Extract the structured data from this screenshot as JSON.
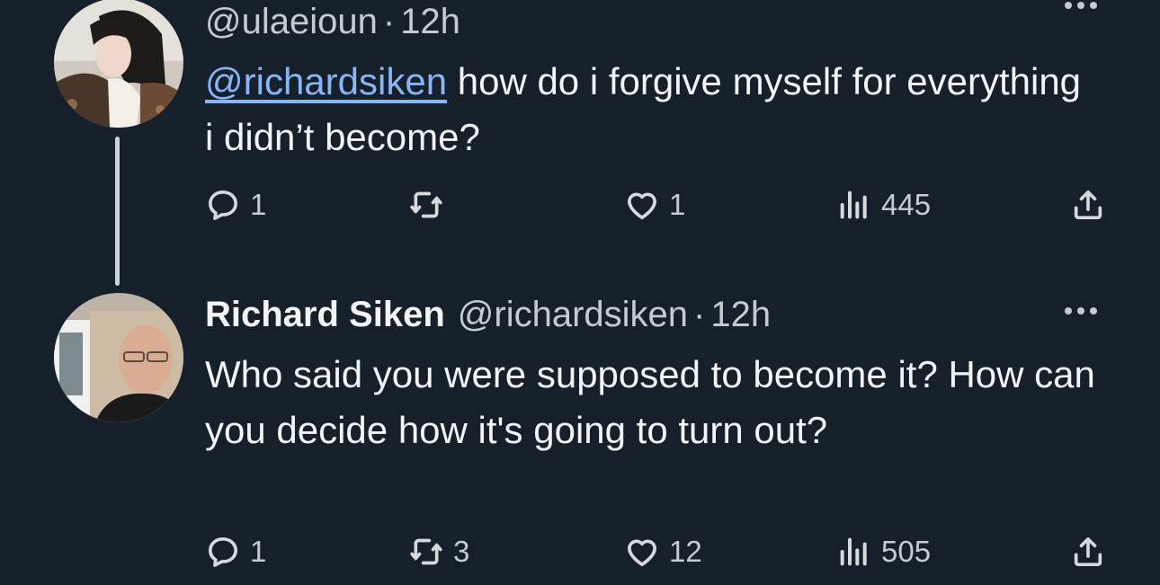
{
  "tweets": [
    {
      "handle": "@ulaeioun",
      "time": "12h",
      "mention": "@richardsiken",
      "text": "how do i forgive myself for everything i didn’t become?",
      "replies": "1",
      "retweets": "",
      "likes": "1",
      "views": "445",
      "icons": [
        "reply-icon",
        "retweet-icon",
        "like-icon",
        "views-icon",
        "share-icon",
        "more-icon"
      ]
    },
    {
      "name": "Richard Siken",
      "handle": "@richardsiken",
      "time": "12h",
      "text": "Who said you were supposed to become it? How can you decide how it's going to turn out?",
      "replies": "1",
      "retweets": "3",
      "likes": "12",
      "views": "505"
    }
  ],
  "separator": "·",
  "colors": {
    "background": "#15202b",
    "mention": "#8ab4f8",
    "text": "#e7e9ea",
    "secondary": "#c6cbd0"
  }
}
